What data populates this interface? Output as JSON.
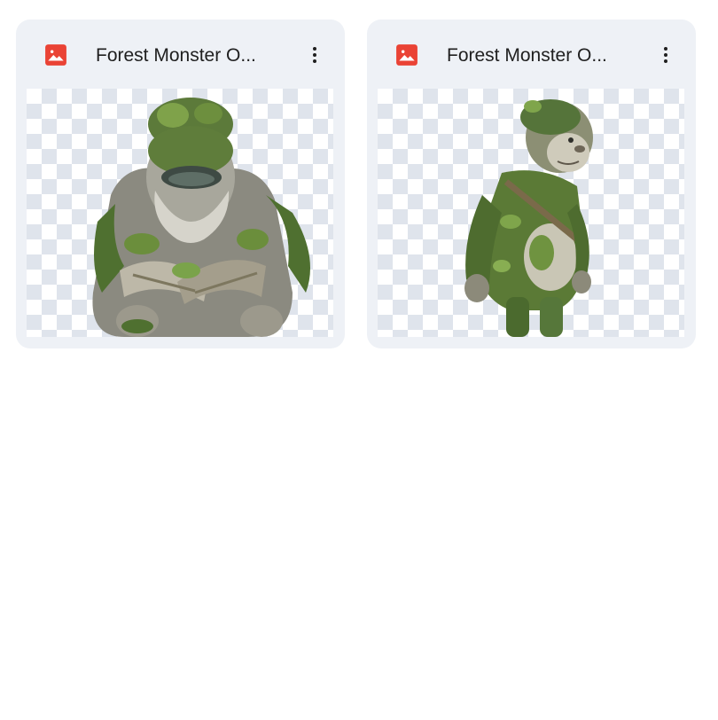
{
  "files": [
    {
      "title": "Forest Monster O...",
      "file_type_icon": "image-icon",
      "menu_icon": "more-vert-icon",
      "thumbnail": "forest-monster-sitting"
    },
    {
      "title": "Forest Monster O...",
      "file_type_icon": "image-icon",
      "menu_icon": "more-vert-icon",
      "thumbnail": "forest-monster-standing"
    }
  ],
  "colors": {
    "card_background": "#eef1f6",
    "image_icon": "#ea4335",
    "title_text": "#1f1f1f",
    "checker": "#dfe4ec"
  }
}
